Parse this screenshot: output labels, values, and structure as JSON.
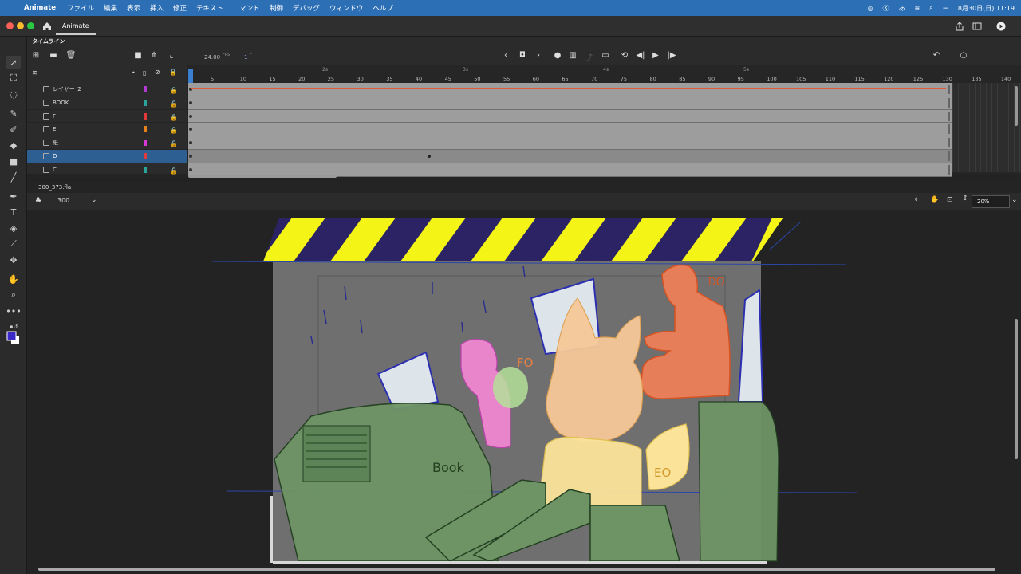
{
  "menubar": {
    "app_name": "Animate",
    "items": [
      "ファイル",
      "編集",
      "表示",
      "挿入",
      "修正",
      "テキスト",
      "コマンド",
      "制御",
      "デバッグ",
      "ウィンドウ",
      "ヘルプ"
    ],
    "datetime": "8月30日(日)  11:19"
  },
  "titlebar": {
    "doc_tab": "Animate"
  },
  "timeline": {
    "panel_title": "タイムライン",
    "fps": "24.00",
    "fps_unit": "FPS",
    "current_frame": "1",
    "frame_unit": "F",
    "frame_numbers": [
      "5",
      "10",
      "15",
      "20",
      "25",
      "30",
      "35",
      "40",
      "45",
      "50",
      "55",
      "60",
      "65",
      "70",
      "75",
      "80",
      "85",
      "90",
      "95",
      "100",
      "105",
      "110",
      "115",
      "120",
      "125",
      "130",
      "135",
      "140"
    ],
    "second_markers": [
      "2s",
      "3s",
      "4s",
      "5s"
    ],
    "layers": [
      {
        "name": "レイヤー_2",
        "color": "#b23ad0",
        "locked": true,
        "active": false
      },
      {
        "name": "BOOK",
        "color": "#2aa39a",
        "locked": true,
        "active": false
      },
      {
        "name": "F",
        "color": "#e23a3a",
        "locked": true,
        "active": false
      },
      {
        "name": "E",
        "color": "#e8801c",
        "locked": true,
        "active": false
      },
      {
        "name": "紙",
        "color": "#d63ad6",
        "locked": true,
        "active": false
      },
      {
        "name": "D",
        "color": "#e23a3a",
        "locked": false,
        "active": true
      },
      {
        "name": "C",
        "color": "#2aa39a",
        "locked": true,
        "active": false
      }
    ]
  },
  "document": {
    "file_name": "300_373.fla",
    "scene_name": "300",
    "zoom": "20%"
  },
  "canvas": {
    "stroke_label": "Book",
    "stage_colors": {
      "stripe_yellow": "#f4f416",
      "stripe_navy": "#2b2364",
      "green": "#6e9466",
      "orange": "#f08058",
      "pink": "#f088d0",
      "fox": "#f6c898",
      "yellow": "#fbe39a"
    }
  }
}
